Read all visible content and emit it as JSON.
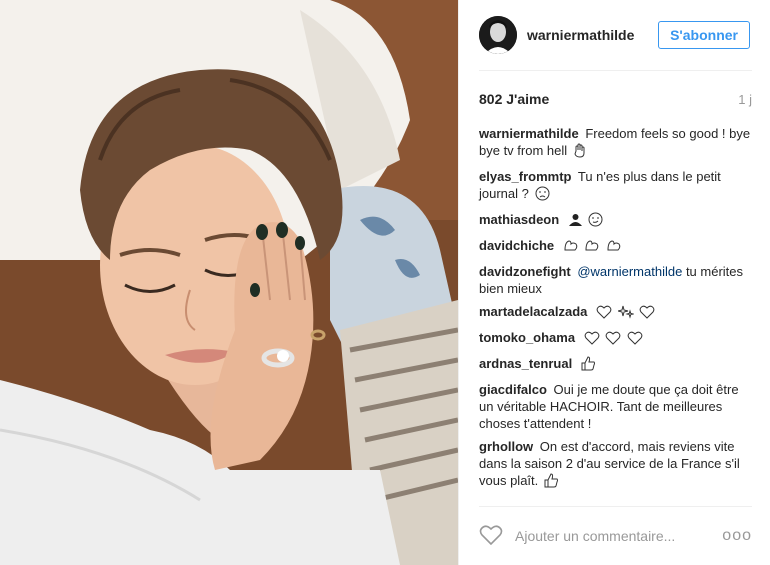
{
  "header": {
    "username": "warniermathilde",
    "follow_label": "S'abonner"
  },
  "stats": {
    "likes": "802 J'aime",
    "time": "1 j"
  },
  "comments": [
    {
      "user": "warniermathilde",
      "text": "Freedom feels so good ! bye bye tv from hell",
      "emoji": "hand-icon"
    },
    {
      "user": "elyas_frommtp",
      "text": "Tu n'es plus dans le petit journal ?",
      "emoji": "crying-face-icon"
    },
    {
      "user": "mathiasdeon",
      "text": "",
      "emoji": "silhouette-icon smirk-icon"
    },
    {
      "user": "davidchiche",
      "text": "",
      "emoji": "biceps-icon x3"
    },
    {
      "user": "davidzonefight",
      "mention": "@warniermathilde",
      "text": "tu mérites bien mieux"
    },
    {
      "user": "martadelacalzada",
      "text": "",
      "emoji": "heart-icon sparkle-icon heart-icon"
    },
    {
      "user": "tomoko_ohama",
      "text": "",
      "emoji": "heart-icon x3"
    },
    {
      "user": "ardnas_tenrual",
      "text": "",
      "emoji": "thumbs-up-icon"
    },
    {
      "user": "giacdifalco",
      "text": "Oui je me doute que ça doit être un véritable HACHOIR. Tant de meilleures choses t'attendent !"
    },
    {
      "user": "grhollow",
      "text": "On est d'accord, mais reviens vite dans la saison 2 d'au service de la France s'il vous plaît.",
      "emoji": "thumbs-up-icon"
    }
  ],
  "footer": {
    "placeholder": "Ajouter un commentaire...",
    "more": "ooo"
  },
  "colors": {
    "accent": "#3897f0",
    "text": "#262626",
    "muted": "#999999",
    "divider": "#efefef"
  }
}
